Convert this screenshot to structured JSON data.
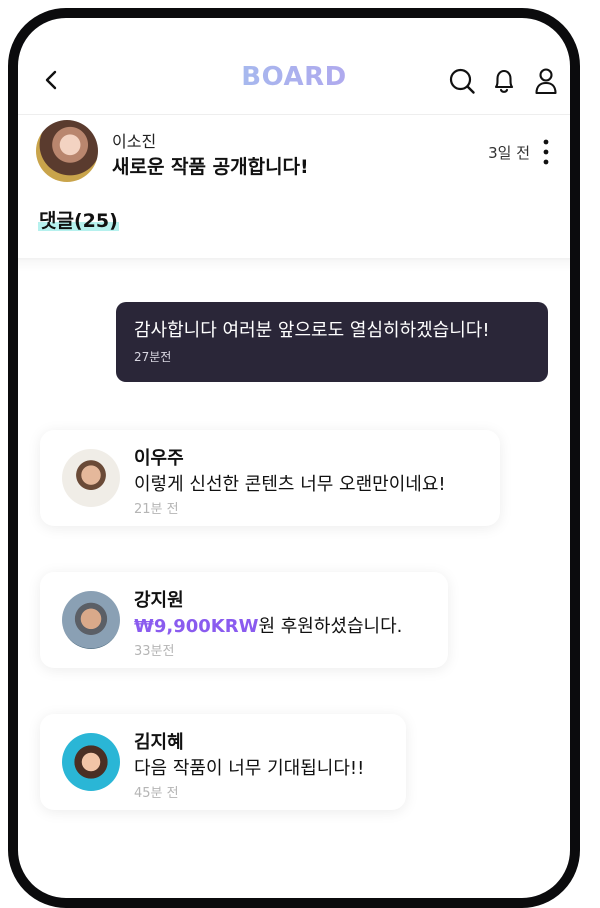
{
  "header": {
    "logo": "BOARD",
    "icons": [
      "back-icon",
      "search-icon",
      "bell-icon",
      "user-icon"
    ]
  },
  "post": {
    "author": "이소진",
    "title": "새로운 작품 공개합니다!",
    "time": "3일 전",
    "comments_label": "댓글(25)"
  },
  "own_comment": {
    "text": "감사합니다 여러분 앞으로도 열심히하겠습니다!",
    "time": "27분전"
  },
  "comments": [
    {
      "name": "이우주",
      "text": "이렇게 신선한 콘텐츠 너무 오랜만이네요!",
      "time": "21분 전"
    },
    {
      "name": "강지원",
      "amount": "₩9,900KRW",
      "text": "원 후원하셨습니다.",
      "time": "33분전"
    },
    {
      "name": "김지혜",
      "text": "다음 작품이 너무 기대됩니다!!",
      "time": "45분 전"
    }
  ]
}
